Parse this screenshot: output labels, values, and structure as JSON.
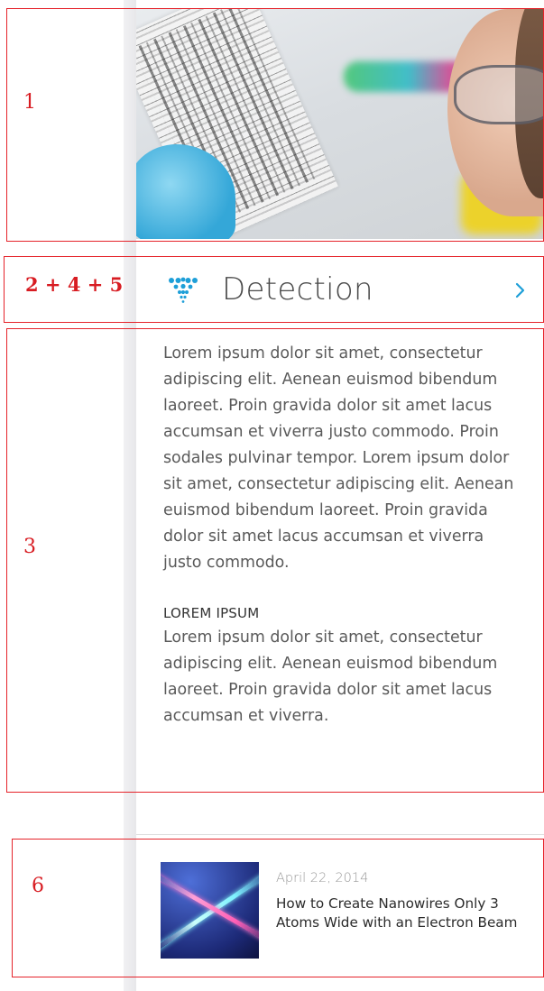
{
  "section": {
    "title": "Detection"
  },
  "body": {
    "paragraph1": "Lorem ipsum dolor sit amet, consectetur adipiscing elit. Aenean euismod bibendum laoreet. Proin gravida dolor sit amet lacus accumsan et viverra justo commodo. Proin sodales pulvinar tempor. Lorem ipsum dolor sit amet, consectetur adipiscing elit. Aenean euismod bibendum laoreet. Proin gravida dolor sit amet lacus accumsan et viverra justo commodo.",
    "subheading": "LOREM IPSUM",
    "paragraph2": "Lorem ipsum dolor sit amet, consectetur adipiscing elit. Aenean euismod bibendum laoreet. Proin gravida dolor sit amet lacus accumsan et viverra."
  },
  "news": {
    "date": "April 22, 2014",
    "headline": "How to Create Nanowires Only 3 Atoms Wide with an Electron Beam"
  },
  "annotations": {
    "hero_label": "1",
    "title_label": "2 + 4 + 5",
    "body_label": "3",
    "news_label": "6"
  },
  "colors": {
    "accent": "#1e9fd8",
    "annotation": "#e5232a",
    "title_text": "#4a4a4a",
    "body_text": "#5a5a5a"
  },
  "icons": {
    "brand": "dot-cluster-logo-icon",
    "next": "chevron-right-icon"
  }
}
